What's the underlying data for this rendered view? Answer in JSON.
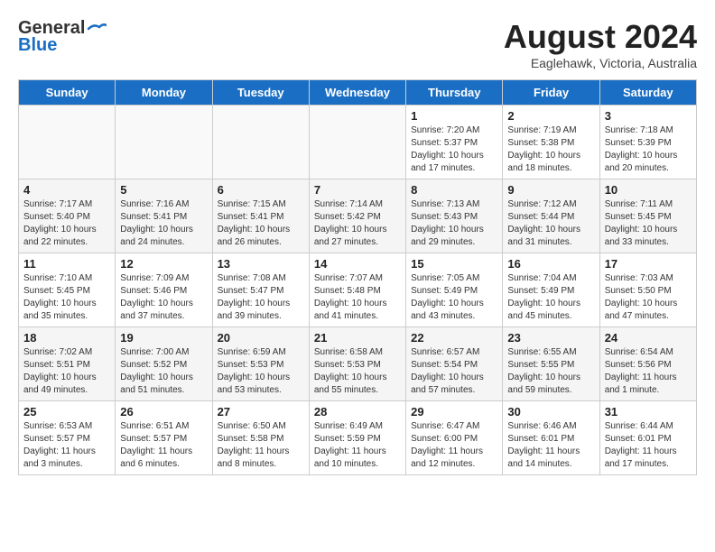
{
  "header": {
    "logo_general": "General",
    "logo_blue": "Blue",
    "month": "August 2024",
    "location": "Eaglehawk, Victoria, Australia"
  },
  "days_of_week": [
    "Sunday",
    "Monday",
    "Tuesday",
    "Wednesday",
    "Thursday",
    "Friday",
    "Saturday"
  ],
  "weeks": [
    {
      "row_class": "row-white",
      "days": [
        {
          "num": "",
          "empty": true
        },
        {
          "num": "",
          "empty": true
        },
        {
          "num": "",
          "empty": true
        },
        {
          "num": "",
          "empty": true
        },
        {
          "num": "1",
          "sunrise": "7:20 AM",
          "sunset": "5:37 PM",
          "daylight": "10 hours and 17 minutes."
        },
        {
          "num": "2",
          "sunrise": "7:19 AM",
          "sunset": "5:38 PM",
          "daylight": "10 hours and 18 minutes."
        },
        {
          "num": "3",
          "sunrise": "7:18 AM",
          "sunset": "5:39 PM",
          "daylight": "10 hours and 20 minutes."
        }
      ]
    },
    {
      "row_class": "row-gray",
      "days": [
        {
          "num": "4",
          "sunrise": "7:17 AM",
          "sunset": "5:40 PM",
          "daylight": "10 hours and 22 minutes."
        },
        {
          "num": "5",
          "sunrise": "7:16 AM",
          "sunset": "5:41 PM",
          "daylight": "10 hours and 24 minutes."
        },
        {
          "num": "6",
          "sunrise": "7:15 AM",
          "sunset": "5:41 PM",
          "daylight": "10 hours and 26 minutes."
        },
        {
          "num": "7",
          "sunrise": "7:14 AM",
          "sunset": "5:42 PM",
          "daylight": "10 hours and 27 minutes."
        },
        {
          "num": "8",
          "sunrise": "7:13 AM",
          "sunset": "5:43 PM",
          "daylight": "10 hours and 29 minutes."
        },
        {
          "num": "9",
          "sunrise": "7:12 AM",
          "sunset": "5:44 PM",
          "daylight": "10 hours and 31 minutes."
        },
        {
          "num": "10",
          "sunrise": "7:11 AM",
          "sunset": "5:45 PM",
          "daylight": "10 hours and 33 minutes."
        }
      ]
    },
    {
      "row_class": "row-white",
      "days": [
        {
          "num": "11",
          "sunrise": "7:10 AM",
          "sunset": "5:45 PM",
          "daylight": "10 hours and 35 minutes."
        },
        {
          "num": "12",
          "sunrise": "7:09 AM",
          "sunset": "5:46 PM",
          "daylight": "10 hours and 37 minutes."
        },
        {
          "num": "13",
          "sunrise": "7:08 AM",
          "sunset": "5:47 PM",
          "daylight": "10 hours and 39 minutes."
        },
        {
          "num": "14",
          "sunrise": "7:07 AM",
          "sunset": "5:48 PM",
          "daylight": "10 hours and 41 minutes."
        },
        {
          "num": "15",
          "sunrise": "7:05 AM",
          "sunset": "5:49 PM",
          "daylight": "10 hours and 43 minutes."
        },
        {
          "num": "16",
          "sunrise": "7:04 AM",
          "sunset": "5:49 PM",
          "daylight": "10 hours and 45 minutes."
        },
        {
          "num": "17",
          "sunrise": "7:03 AM",
          "sunset": "5:50 PM",
          "daylight": "10 hours and 47 minutes."
        }
      ]
    },
    {
      "row_class": "row-gray",
      "days": [
        {
          "num": "18",
          "sunrise": "7:02 AM",
          "sunset": "5:51 PM",
          "daylight": "10 hours and 49 minutes."
        },
        {
          "num": "19",
          "sunrise": "7:00 AM",
          "sunset": "5:52 PM",
          "daylight": "10 hours and 51 minutes."
        },
        {
          "num": "20",
          "sunrise": "6:59 AM",
          "sunset": "5:53 PM",
          "daylight": "10 hours and 53 minutes."
        },
        {
          "num": "21",
          "sunrise": "6:58 AM",
          "sunset": "5:53 PM",
          "daylight": "10 hours and 55 minutes."
        },
        {
          "num": "22",
          "sunrise": "6:57 AM",
          "sunset": "5:54 PM",
          "daylight": "10 hours and 57 minutes."
        },
        {
          "num": "23",
          "sunrise": "6:55 AM",
          "sunset": "5:55 PM",
          "daylight": "10 hours and 59 minutes."
        },
        {
          "num": "24",
          "sunrise": "6:54 AM",
          "sunset": "5:56 PM",
          "daylight": "11 hours and 1 minute."
        }
      ]
    },
    {
      "row_class": "row-white",
      "days": [
        {
          "num": "25",
          "sunrise": "6:53 AM",
          "sunset": "5:57 PM",
          "daylight": "11 hours and 3 minutes."
        },
        {
          "num": "26",
          "sunrise": "6:51 AM",
          "sunset": "5:57 PM",
          "daylight": "11 hours and 6 minutes."
        },
        {
          "num": "27",
          "sunrise": "6:50 AM",
          "sunset": "5:58 PM",
          "daylight": "11 hours and 8 minutes."
        },
        {
          "num": "28",
          "sunrise": "6:49 AM",
          "sunset": "5:59 PM",
          "daylight": "11 hours and 10 minutes."
        },
        {
          "num": "29",
          "sunrise": "6:47 AM",
          "sunset": "6:00 PM",
          "daylight": "11 hours and 12 minutes."
        },
        {
          "num": "30",
          "sunrise": "6:46 AM",
          "sunset": "6:01 PM",
          "daylight": "11 hours and 14 minutes."
        },
        {
          "num": "31",
          "sunrise": "6:44 AM",
          "sunset": "6:01 PM",
          "daylight": "11 hours and 17 minutes."
        }
      ]
    }
  ]
}
